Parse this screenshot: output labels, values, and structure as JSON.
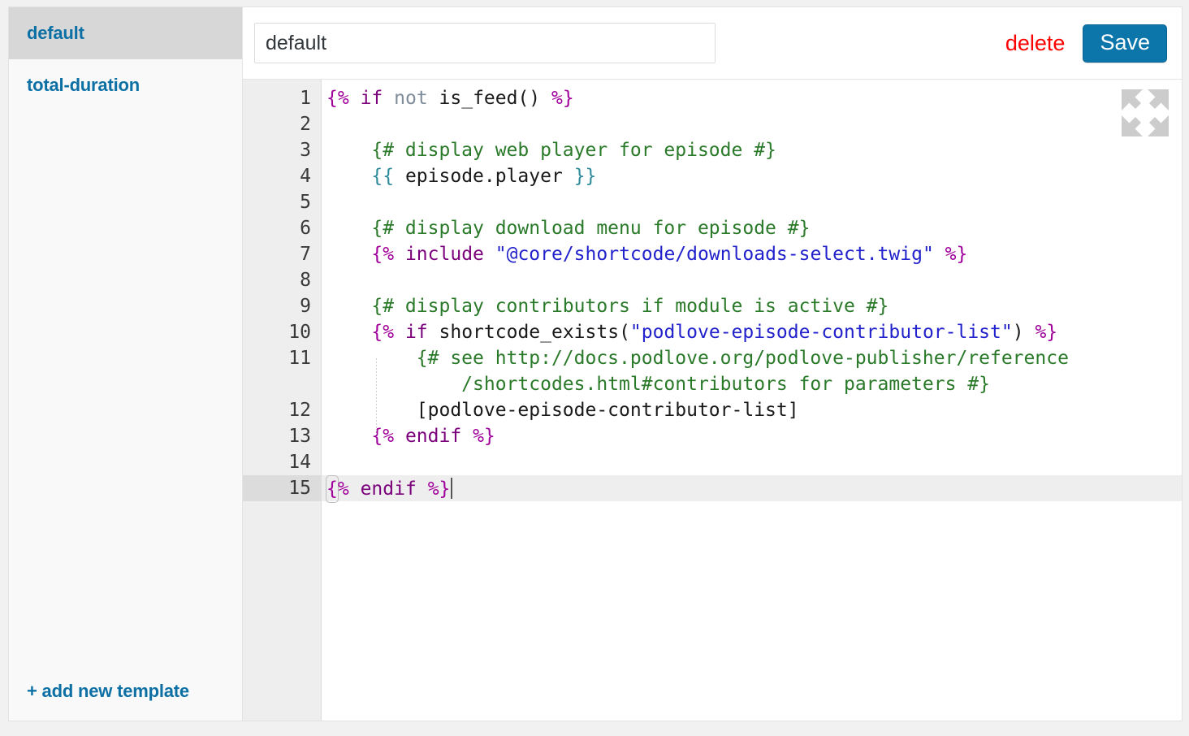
{
  "sidebar": {
    "items": [
      {
        "label": "default",
        "selected": true
      },
      {
        "label": "total-duration",
        "selected": false
      }
    ],
    "add_new_label": "+ add new template"
  },
  "toolbar": {
    "title_value": "default",
    "title_placeholder": "template name",
    "delete_label": "delete",
    "save_label": "Save"
  },
  "editor": {
    "active_line": 15,
    "total_lines": 15,
    "collapse_icon": "collapse-arrows-icon",
    "line_numbers": [
      "1",
      "2",
      "3",
      "4",
      "5",
      "6",
      "7",
      "8",
      "9",
      "10",
      "11",
      "12",
      "13",
      "14",
      "15"
    ],
    "lines": [
      "{% if not is_feed() %}",
      "",
      "    {# display web player for episode #}",
      "    {{ episode.player }}",
      "",
      "    {# display download menu for episode #}",
      "    {% include \"@core/shortcode/downloads-select.twig\" %}",
      "",
      "    {# display contributors if module is active #}",
      "    {% if shortcode_exists(\"podlove-episode-contributor-list\") %}",
      "        {# see http://docs.podlove.org/podlove-publisher/reference/shortcodes.html#contributors for parameters #}",
      "        [podlove-episode-contributor-list]",
      "    {% endif %}",
      "",
      "{% endif %}"
    ]
  },
  "colors": {
    "accent_blue": "#0c70a4",
    "save_button": "#0c76ab",
    "delete_red": "#ff0000",
    "tag_magenta": "#a0009b",
    "keyword_purple": "#7b007b",
    "string_blue": "#2222cc",
    "comment_green": "#2a7a2a",
    "variable_teal": "#2c8a9a",
    "gutter_bg": "#eeeeee",
    "selected_row": "#d7d7d7"
  }
}
